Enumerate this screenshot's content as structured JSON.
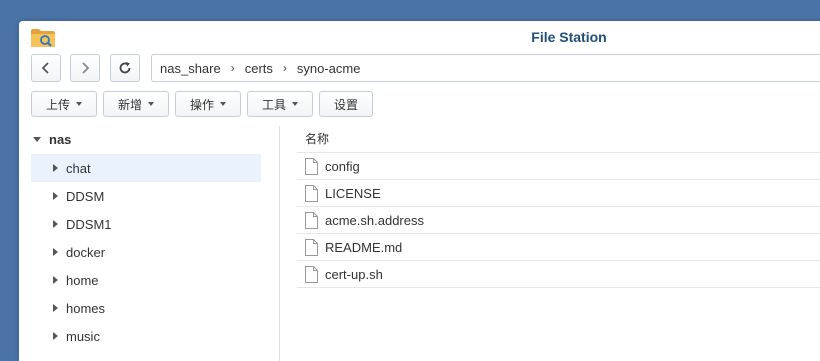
{
  "window": {
    "title": "File Station",
    "accent": "#1f4f7a",
    "desktop_bg": "#4a74a8"
  },
  "nav": {
    "back_icon": "chevron-left-icon",
    "forward_icon": "chevron-right-icon",
    "refresh_icon": "refresh-icon",
    "path": [
      "nas_share",
      "certs",
      "syno-acme"
    ],
    "separator": "›"
  },
  "toolbar": {
    "upload_label": "上传",
    "new_label": "新增",
    "action_label": "操作",
    "tools_label": "工具",
    "settings_label": "设置"
  },
  "sidebar": {
    "root_label": "nas",
    "items": [
      {
        "label": "chat",
        "selected": true
      },
      {
        "label": "DDSM",
        "selected": false
      },
      {
        "label": "DDSM1",
        "selected": false
      },
      {
        "label": "docker",
        "selected": false
      },
      {
        "label": "home",
        "selected": false
      },
      {
        "label": "homes",
        "selected": false
      },
      {
        "label": "music",
        "selected": false
      }
    ]
  },
  "files": {
    "column_name": "名称",
    "rows": [
      {
        "name": "config",
        "icon": "file-icon"
      },
      {
        "name": "LICENSE",
        "icon": "file-icon"
      },
      {
        "name": "acme.sh.address",
        "icon": "file-icon"
      },
      {
        "name": "README.md",
        "icon": "file-icon"
      },
      {
        "name": "cert-up.sh",
        "icon": "file-icon"
      }
    ]
  }
}
